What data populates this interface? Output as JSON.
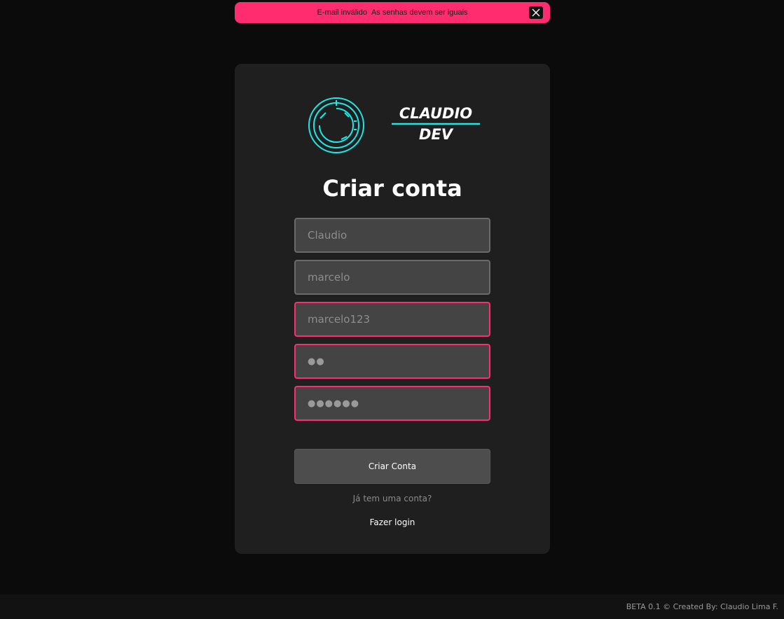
{
  "toast": {
    "messages": [
      "E-mail inválido",
      "As senhas devem ser iguais"
    ],
    "close_icon": "close-icon",
    "color": "#ff2d6f"
  },
  "logo": {
    "text_line1": "CLAUDIO",
    "text_line2": "DEV",
    "accent_color": "#1de9e9"
  },
  "form": {
    "title": "Criar conta",
    "fields": [
      {
        "name": "first-name-field",
        "value": "Claudio",
        "error": false
      },
      {
        "name": "last-name-field",
        "value": "marcelo",
        "error": false
      },
      {
        "name": "email-field",
        "value": "marcelo123",
        "error": true
      },
      {
        "name": "password-field",
        "value": "●●",
        "error": true
      },
      {
        "name": "confirm-password-field",
        "value": "●●●●●●",
        "error": true
      }
    ],
    "submit_label": "Criar Conta",
    "have_account_text": "Já tem uma conta?",
    "login_link": "Fazer login",
    "error_color": "#ff2d6f"
  },
  "footer": {
    "text": "BETA 0.1 © Created By: Claudio Lima F."
  }
}
